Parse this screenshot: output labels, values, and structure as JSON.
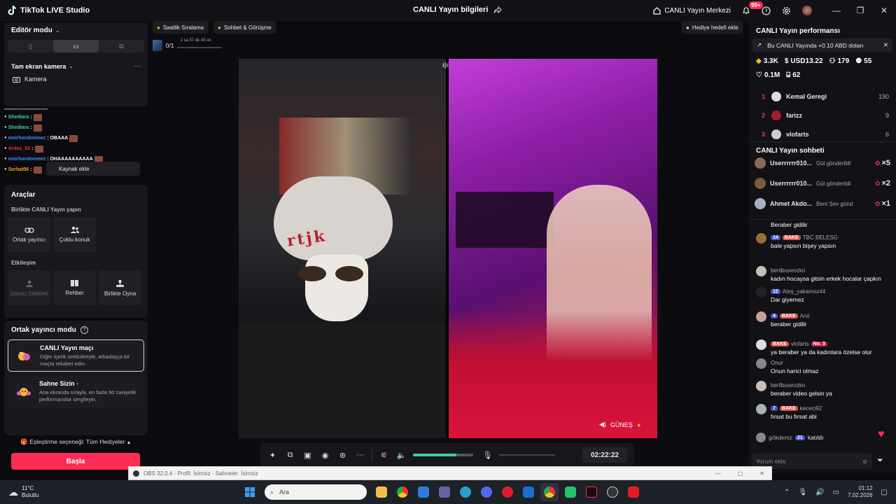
{
  "titlebar": {
    "app_name": "TikTok LIVE Studio",
    "stream_info": "CANLI Yayın bilgileri",
    "live_center": "CANLI Yayın Merkezi",
    "notif_count": "99+"
  },
  "left": {
    "editor_mode": "Editör modu",
    "camera_source": "Tam ekran kamera",
    "camera_item": "Kamera",
    "chat_overlay": [
      {
        "user": "Shediara",
        "text": ":",
        "color": "#3fd19a"
      },
      {
        "user": "Shediara",
        "text": ":",
        "color": "#3fd19a"
      },
      {
        "user": "emirhandonmez",
        "text": ": OBAAA",
        "color": "#3a8cff"
      },
      {
        "user": "Ardas_52",
        "text": ":",
        "color": "#e0303a"
      },
      {
        "user": "emirhandonmez",
        "text": ": OHAAAAAAAAAA",
        "color": "#3a8cff"
      },
      {
        "user": "Serhat06",
        "text": ":",
        "color": "#f0a020"
      }
    ],
    "add_source": "Kaynak ekle",
    "tools_title": "Araçlar",
    "together_live": "Birlikte CANLI Yayın yapın",
    "tools_row1": [
      "Ortak yayıncı",
      "Çoklu konuk"
    ],
    "interaction": "Etkileşim",
    "tools_row2": [
      "İzleyici Dilekleri",
      "Rehber",
      "Birlikte Oyna"
    ],
    "cohost_mode": "Ortak yayıncı modu",
    "match_title": "CANLI Yayın maçı",
    "match_desc": "Diğer içerik üreticileriyle, arkadaşça bir maçta rekabet edin.",
    "stage_title": "Sahne Sizin",
    "stage_desc": "Ana ekranda sırayla, en fazla 90 saniyelik performanslar sergileyin.",
    "pairing": "Eşleştirme seçeneği: Tüm Hediyeler",
    "start": "Başla"
  },
  "center": {
    "hourly_rank": "Saatlik Sıralama",
    "chat_match": "Sohbet & Görüşme",
    "gift_goal": "Hediye hedefi ekle",
    "goal_progress": "0/1",
    "goal_time": "1 sa 37 dk 43 sn",
    "partner_name": "GÜNEŞ",
    "timer": "02:22:22",
    "volume_level": 0.72
  },
  "right": {
    "perf_title": "CANLI Yayın performansı",
    "promo": "Bu CANLI Yayında +0.10 ABD doları",
    "stats": {
      "diamonds": "3.3K",
      "usd": "USD13.22",
      "viewers": "179",
      "new_followers": "55",
      "likes": "0.1M",
      "gifters": "62"
    },
    "ranking": [
      {
        "n": "1",
        "name": "Kemal Geregi",
        "score": "190"
      },
      {
        "n": "2",
        "name": "farizz",
        "score": "9"
      },
      {
        "n": "3",
        "name": "vlofarts",
        "score": "6"
      }
    ],
    "chat_title": "CANLI Yayın sohbeti",
    "gifts": [
      {
        "user": "Userrrrrr010...",
        "action": "Gül gönderildi",
        "count": "×5"
      },
      {
        "user": "Userrrrrr010...",
        "action": "Gül gönderildi",
        "count": "×2"
      },
      {
        "user": "Ahmet Akdo...",
        "action": "Beni Sev gönd",
        "count": "×1"
      }
    ],
    "comments": [
      {
        "user": "",
        "text": "Beraber gidilir"
      },
      {
        "user": "TBC BELESG",
        "text": "bale yapsın bişey yapsın",
        "lvl": "14",
        "bake": "BAKE"
      },
      {
        "user": "berilbuseozkn",
        "text": "kadın hocaysa gitsin erkek hocalar çapkın"
      },
      {
        "user": "Ateş_yakamoz44",
        "text": "Dar giyemez",
        "lvl": "12"
      },
      {
        "user": "Anıl",
        "text": "beraber gidilir",
        "lvl": "4",
        "bake": "BAKE"
      },
      {
        "user": "vlofarts",
        "text": "ya beraber ya da kadınlara özelse olur",
        "bake": "BAKE",
        "no": "No. 3"
      },
      {
        "user": "Onur",
        "text": "Onun harici olmaz"
      },
      {
        "user": "berilbuseozkn",
        "text": "beraber video gelsin ya"
      },
      {
        "user": "kececi92",
        "text": "fırsat bu fırsat abi",
        "lvl": "7",
        "bake": "BAKE"
      }
    ],
    "joined_user": "gökdeniz",
    "joined_lvl": "21",
    "joined_text": "katıldı",
    "comment_placeholder": "Yorum ekle"
  },
  "obs": {
    "text": "OBS 32.0.4 - Profil: İsimsiz - Sahneler: İsimsiz"
  },
  "taskbar": {
    "temp": "11°C",
    "weather": "Bulutlu",
    "search": "Ara",
    "time": "01:12",
    "date": "7.02.2026"
  }
}
